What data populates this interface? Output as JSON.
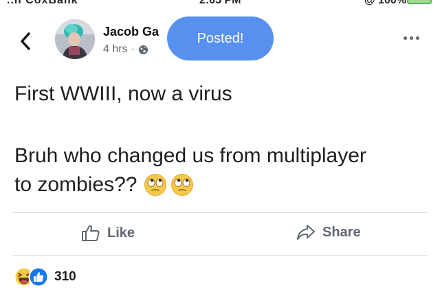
{
  "status_bar": {
    "carrier": "..ll CoxBank",
    "time": "2:05 PM",
    "battery": "@ 100%"
  },
  "header": {
    "author": "Jacob Ga",
    "time_ago": "4 hrs",
    "separator": "·",
    "privacy_icon": "globe-icon",
    "toast": "Posted!",
    "back_icon": "chevron-left-icon",
    "more_icon": "more-dots-icon"
  },
  "post": {
    "line1": "First WWIII, now a virus",
    "line2": "Bruh who changed us from multiplayer",
    "line3": "to zombies??",
    "emojis": [
      "face-with-rolling-eyes-emoji",
      "face-with-rolling-eyes-emoji"
    ]
  },
  "actions": {
    "like_label": "Like",
    "share_label": "Share"
  },
  "reactions": {
    "icons": [
      "haha-reaction",
      "like-reaction"
    ],
    "count": "310"
  },
  "colors": {
    "toast_bg": "#5890f0",
    "text": "#1c1e21",
    "muted": "#606770",
    "like_blue": "#1877f2"
  }
}
